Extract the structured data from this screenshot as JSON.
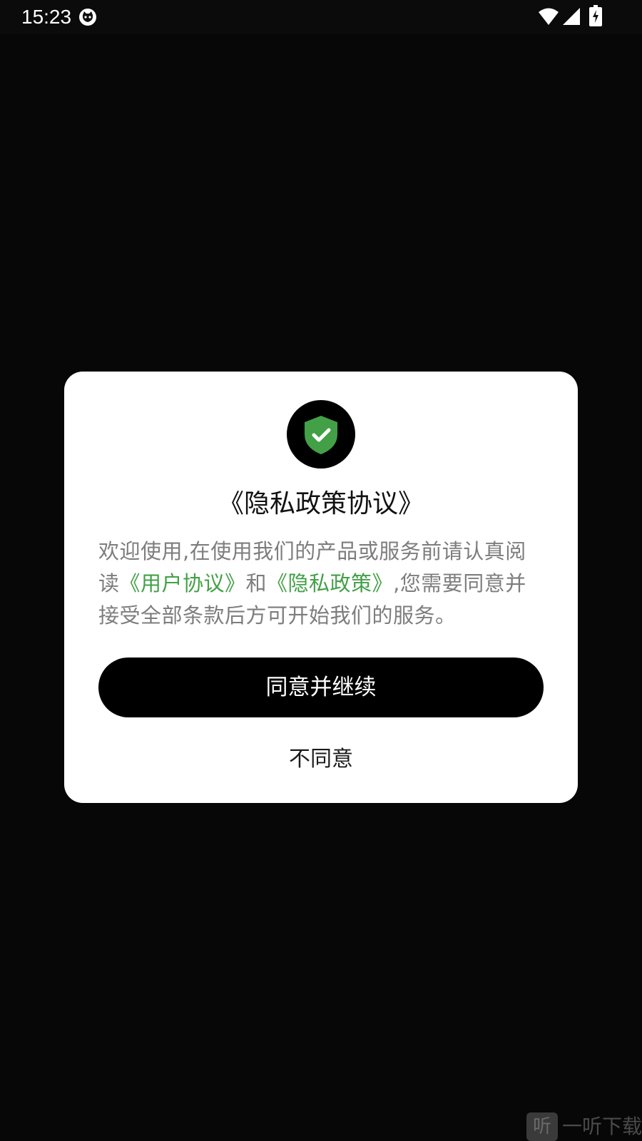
{
  "status_bar": {
    "time": "15:23"
  },
  "dialog": {
    "title": "《隐私政策协议》",
    "body": {
      "part1": "欢迎使用,在使用我们的产品或服务前请认真阅读",
      "user_agreement_link": "《用户协议》",
      "part2": "和",
      "privacy_policy_link": "《隐私政策》",
      "part3": ",您需要同意并接受全部条款后方可开始我们的服务。"
    },
    "agree_button": "同意并继续",
    "disagree_button": "不同意",
    "icon": "shield-check-icon"
  },
  "watermark": {
    "logo_glyph": "听",
    "text": "一听下载"
  },
  "colors": {
    "background": "#070707",
    "link_green": "#43a047",
    "shield_green": "#43a047"
  }
}
